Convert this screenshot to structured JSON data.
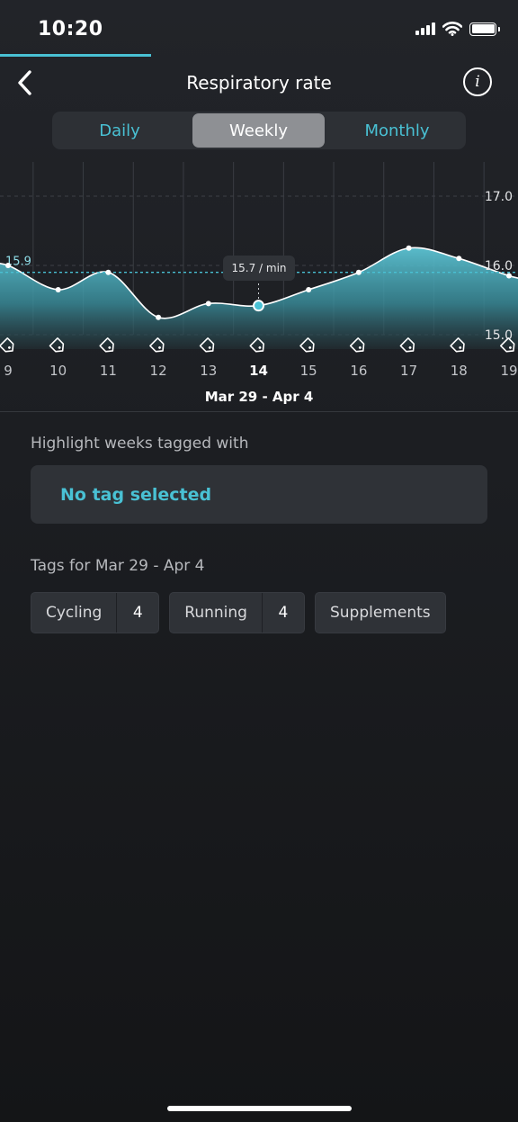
{
  "status_bar": {
    "time": "10:20",
    "icons": [
      "cellular-signal-icon",
      "wifi-icon",
      "battery-icon"
    ]
  },
  "header": {
    "title": "Respiratory rate",
    "back_icon": "chevron-left-icon",
    "info_icon": "info-icon",
    "info_glyph": "i"
  },
  "tabs": [
    {
      "label": "Daily",
      "selected": false
    },
    {
      "label": "Weekly",
      "selected": true
    },
    {
      "label": "Monthly",
      "selected": false
    }
  ],
  "colors": {
    "accent": "#49c1d4",
    "background": "#1f2125",
    "card": "#2f3237",
    "selected_tab": "#8e9094"
  },
  "chart_data": {
    "type": "area",
    "x": [
      "9",
      "10",
      "11",
      "12",
      "13",
      "14",
      "15",
      "16",
      "17",
      "18",
      "19"
    ],
    "values": [
      16.0,
      15.65,
      15.9,
      15.25,
      15.45,
      15.42,
      15.65,
      15.9,
      16.25,
      16.1,
      15.85
    ],
    "selected_index": 5,
    "selected_x_label": "14",
    "tooltip": "15.7 / min",
    "average_line": 15.9,
    "average_label": "15.9",
    "y_ticks": [
      "17.0",
      "16.0",
      "15.0"
    ],
    "ylim": [
      15.0,
      17.0
    ],
    "tag_icon": "tag-icon",
    "range_label": "Mar 29 - Apr 4",
    "grid": true
  },
  "highlight": {
    "label": "Highlight weeks tagged with",
    "value": "No tag selected"
  },
  "tags_section": {
    "label": "Tags for Mar 29 - Apr 4",
    "tags": [
      {
        "name": "Cycling",
        "count": "4"
      },
      {
        "name": "Running",
        "count": "4"
      },
      {
        "name": "Supplements",
        "count": null
      }
    ]
  }
}
